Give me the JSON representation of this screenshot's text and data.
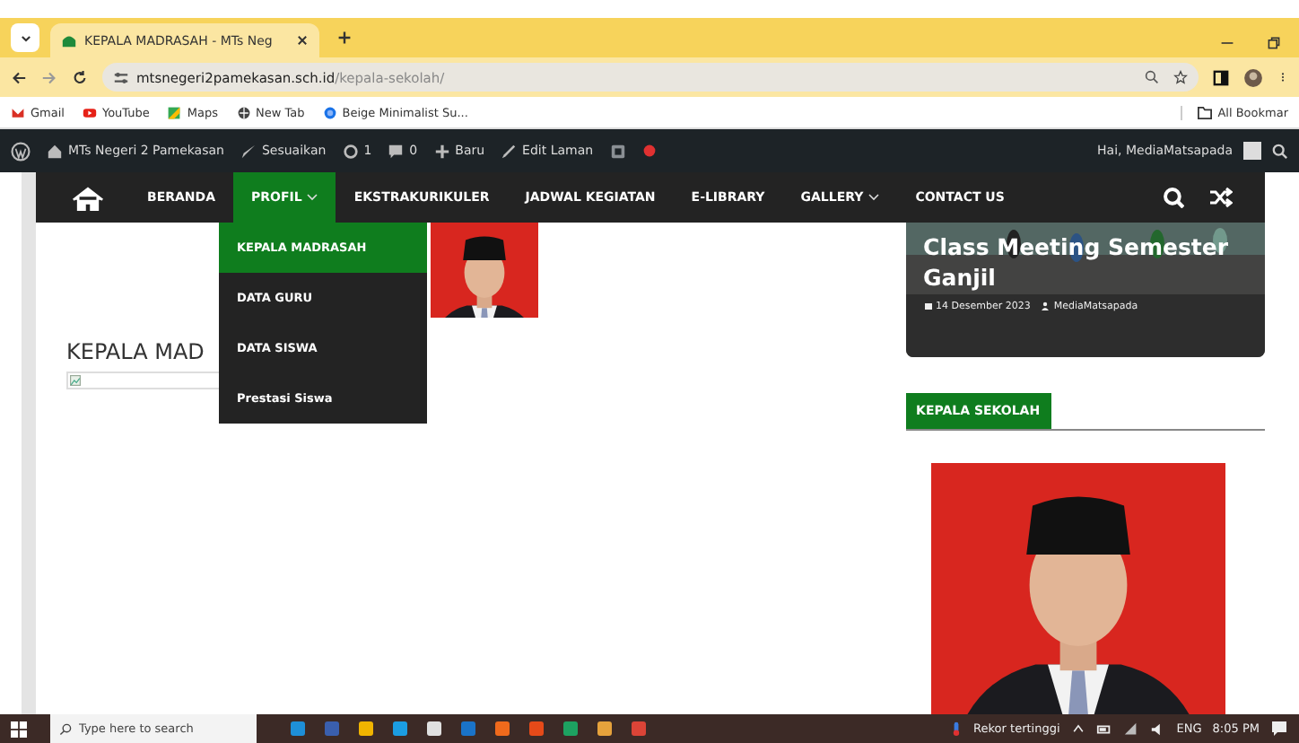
{
  "browser": {
    "tab": {
      "title": "KEPALA MADRASAH - MTs Neg",
      "selected": true
    },
    "url_domain": "mtsnegeri2pamekasan.sch.id",
    "url_path": "/kepala-sekolah/",
    "bookmarks": [
      "Gmail",
      "YouTube",
      "Maps",
      "New Tab",
      "Beige Minimalist Su..."
    ],
    "all_bookmarks": "All Bookmar"
  },
  "admin_bar": {
    "site": "MTs Negeri 2 Pamekasan",
    "customize": "Sesuaikan",
    "updates": "1",
    "comments": "0",
    "new": "Baru",
    "edit": "Edit Laman",
    "greeting": "Hai, MediaMatsapada"
  },
  "nav": {
    "items": [
      {
        "label": "BERANDA",
        "selected": false,
        "dropdown": false
      },
      {
        "label": "PROFIL",
        "selected": true,
        "dropdown": true,
        "children": [
          {
            "label": "KEPALA MADRASAH",
            "selected": true
          },
          {
            "label": "DATA GURU",
            "selected": false
          },
          {
            "label": "DATA SISWA",
            "selected": false
          },
          {
            "label": "Prestasi Siswa",
            "selected": false
          }
        ]
      },
      {
        "label": "EKSTRAKURIKULER",
        "selected": false,
        "dropdown": false
      },
      {
        "label": "JADWAL KEGIATAN",
        "selected": false,
        "dropdown": false
      },
      {
        "label": "E-LIBRARY",
        "selected": false,
        "dropdown": false
      },
      {
        "label": "GALLERY",
        "selected": false,
        "dropdown": true
      },
      {
        "label": "CONTACT US",
        "selected": false,
        "dropdown": false
      }
    ]
  },
  "content": {
    "heading": "KEPALA MAD"
  },
  "sidebar": {
    "post": {
      "title": "Class Meeting Semester Ganjil",
      "date": "14 Desember 2023",
      "author": "MediaMatsapada"
    },
    "widget_title": "KEPALA SEKOLAH"
  },
  "taskbar": {
    "search_placeholder": "Type here to search",
    "weather": "Rekor tertinggi",
    "language": "ENG",
    "time": "8:05 PM"
  }
}
